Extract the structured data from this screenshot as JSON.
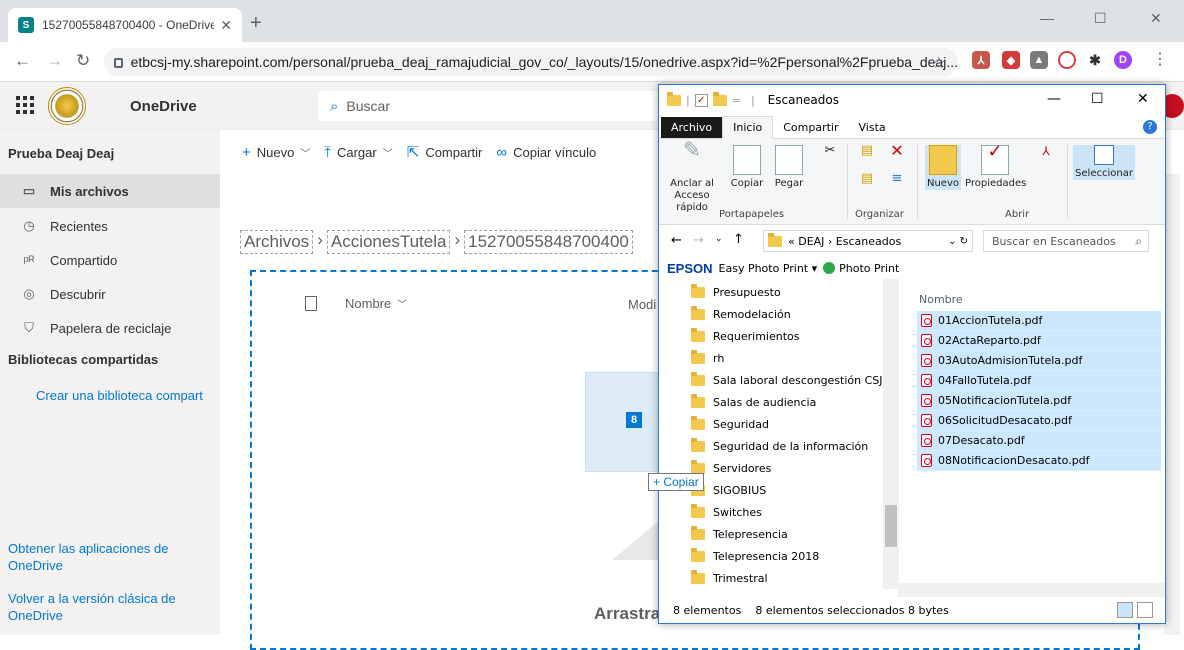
{
  "browser": {
    "tab_title": "15270055848700400 - OneDrive",
    "url": "etbcsj-my.sharepoint.com/personal/prueba_deaj_ramajudicial_gov_co/_layouts/15/onedrive.aspx?id=%2Fpersonal%2Fprueba_deaj...",
    "profile_initial": "D"
  },
  "onedrive": {
    "app_name": "OneDrive",
    "search_placeholder": "Buscar",
    "user_title": "Prueba Deaj Deaj",
    "nav": [
      {
        "label": "Mis archivos",
        "icon": "folder-icon"
      },
      {
        "label": "Recientes",
        "icon": "clock-icon"
      },
      {
        "label": "Compartido",
        "icon": "people-icon"
      },
      {
        "label": "Descubrir",
        "icon": "compass-icon"
      },
      {
        "label": "Papelera de reciclaje",
        "icon": "trash-icon"
      }
    ],
    "libraries_header": "Bibliotecas compartidas",
    "create_library": "Crear una biblioteca compart",
    "get_apps": "Obtener las aplicaciones de OneDrive",
    "classic": "Volver a la versión clásica de OneDrive",
    "commands": {
      "new": "Nuevo",
      "upload": "Cargar",
      "share": "Compartir",
      "copy_link": "Copiar vínculo"
    },
    "breadcrumb": [
      "Archivos",
      "AccionesTutela",
      "15270055848700400"
    ],
    "column_name": "Nombre",
    "column_modified": "Modi",
    "drag_count": "8",
    "copy_tip": "+ Copiar",
    "drop_text": "Arrastra"
  },
  "explorer": {
    "title": "Escaneados",
    "tabs": [
      "Archivo",
      "Inicio",
      "Compartir",
      "Vista"
    ],
    "ribbon": {
      "pin": "Anclar al Acceso rápido",
      "copy": "Copiar",
      "paste": "Pegar",
      "group_clipboard": "Portapapeles",
      "group_organize": "Organizar",
      "new": "Nuevo",
      "properties": "Propiedades",
      "group_open": "Abrir",
      "select": "Seleccionar"
    },
    "path": "« DEAJ › Escaneados",
    "search_placeholder": "Buscar en Escaneados",
    "epson_brand": "EPSON",
    "epson_app": "Easy Photo Print ▾",
    "photo_print": "Photo Print",
    "folders": [
      "Presupuesto",
      "Remodelación",
      "Requerimientos",
      "rh",
      "Sala laboral descongestión CSJ",
      "Salas de audiencia",
      "Seguridad",
      "Seguridad de la información",
      "Servidores",
      "SIGOBIUS",
      "Switches",
      "Telepresencia",
      "Telepresencia 2018",
      "Trimestral"
    ],
    "column_name": "Nombre",
    "files": [
      "01AccionTutela.pdf",
      "02ActaReparto.pdf",
      "03AutoAdmisionTutela.pdf",
      "04FalloTutela.pdf",
      "05NotificacionTutela.pdf",
      "06SolicitudDesacato.pdf",
      "07Desacato.pdf",
      "08NotificacionDesacato.pdf"
    ],
    "status_count": "8 elementos",
    "status_selected": "8 elementos seleccionados 8 bytes"
  }
}
